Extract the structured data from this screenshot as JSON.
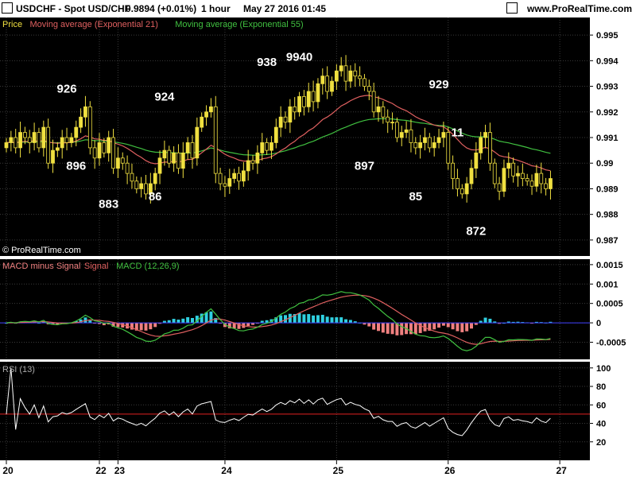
{
  "header": {
    "symbol": "USDCHF - Spot USD/CHF",
    "quote": "0.9894 (+0.01%)",
    "timeframe": "1 hour",
    "datetime": "May 27 2016 01:45",
    "site": "www.ProRealTime.com"
  },
  "colors": {
    "background": "#000000",
    "grid": "#3a3a3a",
    "price": "#f0e040",
    "ema21": "#e06060",
    "ema55": "#40c040",
    "macd_hist_pos": "#30d0e0",
    "macd_hist_neg": "#f08080",
    "macd_signal": "#e06060",
    "macd_line": "#40c040",
    "rsi_line": "#ffffff",
    "rsi_level": "#e02020",
    "zero_line": "#4040ff"
  },
  "chart_data": [
    {
      "type": "candlestick",
      "panel": "price",
      "legend": [
        "Price",
        "Moving average (Exponential 21)",
        "Moving average (Exponential 55)"
      ],
      "watermark": "© ProRealTime.com",
      "ylim": [
        0.9865,
        0.9955
      ],
      "yticks": [
        "0.995",
        "0.994",
        "0.993",
        "0.992",
        "0.991",
        "0.99",
        "0.989",
        "0.988",
        "0.987"
      ],
      "x_labels": [
        {
          "t": 0,
          "label": "20"
        },
        {
          "t": 20,
          "label": "22"
        },
        {
          "t": 24,
          "label": "23"
        },
        {
          "t": 47,
          "label": "24"
        },
        {
          "t": 71,
          "label": "25"
        },
        {
          "t": 95,
          "label": "26"
        },
        {
          "t": 119,
          "label": "27"
        }
      ],
      "close": [
        0.9908,
        0.991,
        0.9906,
        0.9912,
        0.991,
        0.9908,
        0.9912,
        0.9906,
        0.9914,
        0.99,
        0.9905,
        0.9906,
        0.991,
        0.9908,
        0.991,
        0.9914,
        0.9918,
        0.9922,
        0.9906,
        0.9902,
        0.9908,
        0.9904,
        0.991,
        0.9898,
        0.9902,
        0.99,
        0.9896,
        0.9893,
        0.989,
        0.9892,
        0.9888,
        0.9892,
        0.9896,
        0.9902,
        0.9905,
        0.99,
        0.9904,
        0.9898,
        0.9904,
        0.9908,
        0.9902,
        0.9914,
        0.9918,
        0.992,
        0.9922,
        0.9896,
        0.9892,
        0.9891,
        0.9894,
        0.9896,
        0.9893,
        0.9897,
        0.9901,
        0.99,
        0.9904,
        0.9908,
        0.9905,
        0.9908,
        0.9914,
        0.9918,
        0.9916,
        0.9922,
        0.992,
        0.9926,
        0.9922,
        0.9928,
        0.9924,
        0.9931,
        0.9934,
        0.9928,
        0.9932,
        0.9936,
        0.9938,
        0.9932,
        0.9936,
        0.9934,
        0.9933,
        0.993,
        0.9928,
        0.992,
        0.9922,
        0.9918,
        0.9916,
        0.9916,
        0.991,
        0.9912,
        0.9913,
        0.9908,
        0.9906,
        0.9908,
        0.991,
        0.9906,
        0.9908,
        0.991,
        0.9912,
        0.99,
        0.9894,
        0.989,
        0.9888,
        0.9892,
        0.9898,
        0.9904,
        0.991,
        0.9912,
        0.99,
        0.9892,
        0.9889,
        0.9898,
        0.99,
        0.9895,
        0.9896,
        0.9894,
        0.9893,
        0.9891,
        0.9896,
        0.9892,
        0.989,
        0.9894
      ],
      "annotations": [
        {
          "t": 13,
          "value": 0.99275,
          "label": "926"
        },
        {
          "t": 15,
          "value": 0.98975,
          "label": "896"
        },
        {
          "t": 22,
          "value": 0.98825,
          "label": "883"
        },
        {
          "t": 32,
          "value": 0.98855,
          "label": "86"
        },
        {
          "t": 34,
          "value": 0.99245,
          "label": "924"
        },
        {
          "t": 56,
          "value": 0.9938,
          "label": "938"
        },
        {
          "t": 63,
          "value": 0.994,
          "label": "9940"
        },
        {
          "t": 77,
          "value": 0.98975,
          "label": "897"
        },
        {
          "t": 88,
          "value": 0.98855,
          "label": "85"
        },
        {
          "t": 93,
          "value": 0.99292,
          "label": "929"
        },
        {
          "t": 97,
          "value": 0.99105,
          "label": "11"
        },
        {
          "t": 101,
          "value": 0.9872,
          "label": "872"
        }
      ]
    },
    {
      "type": "bar+line",
      "panel": "macd",
      "legend": [
        "MACD minus Signal",
        "Signal",
        "MACD (12,26,9)"
      ],
      "ylim": [
        -0.0009,
        0.0016
      ],
      "yticks": [
        "0.0015",
        "0.001",
        "0.0005",
        "0",
        "-0.0005"
      ]
    },
    {
      "type": "line",
      "panel": "rsi",
      "legend": [
        "RSI (13)"
      ],
      "ylim": [
        0,
        105
      ],
      "yticks": [
        "100",
        "80",
        "60",
        "40",
        "20"
      ],
      "level": 50
    }
  ]
}
